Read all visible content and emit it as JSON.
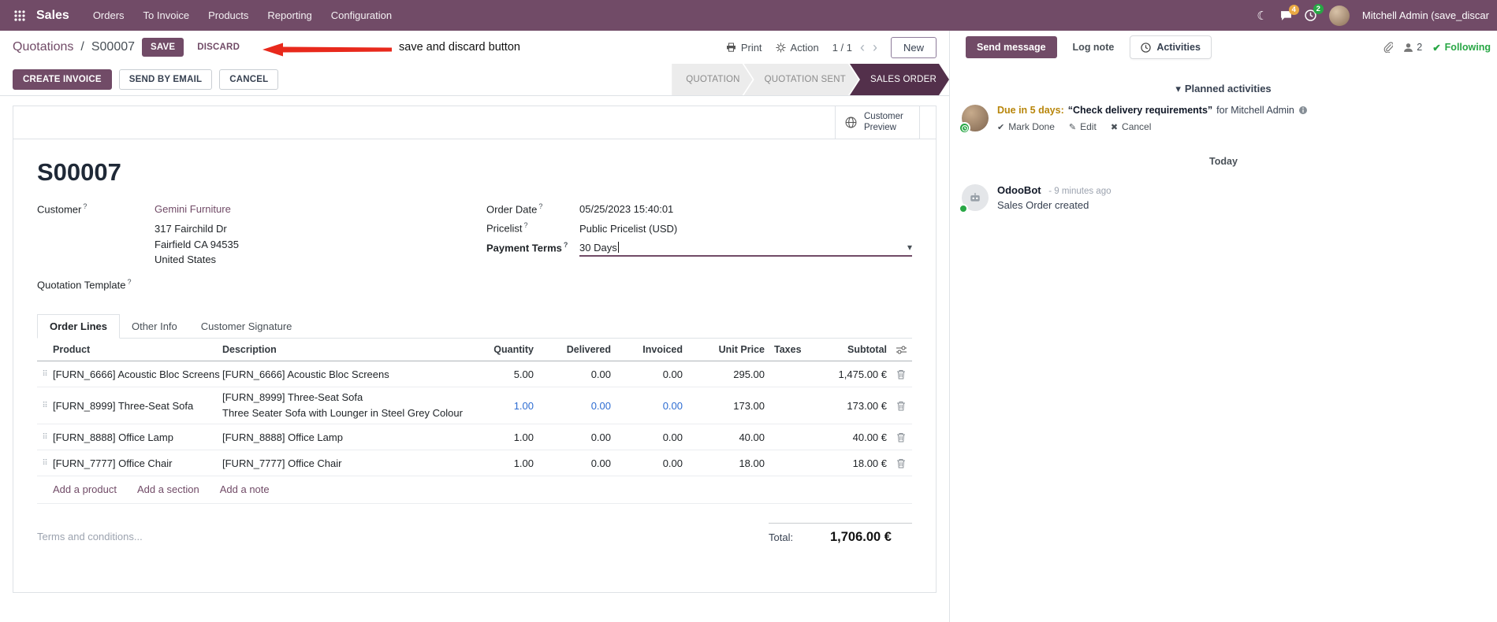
{
  "colors": {
    "brand": "#714B67",
    "topbar_bg": "#714B67",
    "status_active_bg": "#53304b",
    "link": "#714B67",
    "edited_value_blue": "#2e6dd2",
    "activity_due_soon": "#b8860b",
    "success_green": "#28a745",
    "annotation_red": "#e8291c"
  },
  "icons": {
    "moon": "☾",
    "caret_down": "▾",
    "chevron_left": "‹",
    "chevron_right": "›",
    "check": "✔",
    "pencil": "✎",
    "cross": "✖",
    "drag_handle": "⠿"
  },
  "topbar": {
    "brand": "Sales",
    "menus": [
      "Orders",
      "To Invoice",
      "Products",
      "Reporting",
      "Configuration"
    ],
    "messages_badge": "4",
    "activities_badge": "2",
    "user_name": "Mitchell Admin (save_discar"
  },
  "breadcrumb": {
    "parent": "Quotations",
    "separator": "/",
    "current": "S00007",
    "save_label": "SAVE",
    "discard_label": "DISCARD"
  },
  "annotation": {
    "text": "save and discard button"
  },
  "controls": {
    "print_label": "Print",
    "action_label": "Action",
    "pager": "1 / 1",
    "new_label": "New"
  },
  "statusbar": {
    "buttons": [
      "CREATE INVOICE",
      "SEND BY EMAIL",
      "CANCEL"
    ],
    "states": [
      {
        "label": "QUOTATION",
        "active": false
      },
      {
        "label": "QUOTATION SENT",
        "active": false
      },
      {
        "label": "SALES ORDER",
        "active": true
      }
    ]
  },
  "sheet": {
    "customer_preview_label": "Customer Preview",
    "title": "S00007",
    "help_marker": "?",
    "fields": {
      "customer_label": "Customer",
      "customer_value": "Gemini Furniture",
      "address_line1": "317 Fairchild Dr",
      "address_line2": "Fairfield CA 94535",
      "address_line3": "United States",
      "quotation_template_label": "Quotation Template",
      "order_date_label": "Order Date",
      "order_date_value": "05/25/2023 15:40:01",
      "pricelist_label": "Pricelist",
      "pricelist_value": "Public Pricelist (USD)",
      "payment_terms_label": "Payment Terms",
      "payment_terms_value": "30 Days"
    },
    "tabs": [
      "Order Lines",
      "Other Info",
      "Customer Signature"
    ],
    "table": {
      "headers": [
        "Product",
        "Description",
        "Quantity",
        "Delivered",
        "Invoiced",
        "Unit Price",
        "Taxes",
        "Subtotal"
      ],
      "rows": [
        {
          "product": "[FURN_6666] Acoustic Bloc Screens",
          "description": "[FURN_6666] Acoustic Bloc Screens",
          "quantity": "5.00",
          "delivered": "0.00",
          "invoiced": "0.00",
          "unit_price": "295.00",
          "taxes": "",
          "subtotal": "1,475.00 €"
        },
        {
          "product": "[FURN_8999] Three-Seat Sofa",
          "description": "[FURN_8999] Three-Seat Sofa",
          "description_line2": "Three Seater Sofa with Lounger in Steel Grey Colour",
          "quantity": "1.00",
          "delivered": "0.00",
          "invoiced": "0.00",
          "unit_price": "173.00",
          "taxes": "",
          "subtotal": "173.00 €"
        },
        {
          "product": "[FURN_8888] Office Lamp",
          "description": "[FURN_8888] Office Lamp",
          "quantity": "1.00",
          "delivered": "0.00",
          "invoiced": "0.00",
          "unit_price": "40.00",
          "taxes": "",
          "subtotal": "40.00 €"
        },
        {
          "product": "[FURN_7777] Office Chair",
          "description": "[FURN_7777] Office Chair",
          "quantity": "1.00",
          "delivered": "0.00",
          "invoiced": "0.00",
          "unit_price": "18.00",
          "taxes": "",
          "subtotal": "18.00 €"
        }
      ],
      "footer_links": [
        "Add a product",
        "Add a section",
        "Add a note"
      ]
    },
    "terms_placeholder": "Terms and conditions...",
    "total_label": "Total:",
    "total_value": "1,706.00 €"
  },
  "chatter": {
    "send_message_label": "Send message",
    "log_note_label": "Log note",
    "activities_label": "Activities",
    "followers_count": "2",
    "following_label": "Following",
    "planned_header": "Planned activities",
    "activity": {
      "due_text": "Due in 5 days:",
      "summary": "“Check delivery requirements”",
      "assignee_text": "for Mitchell Admin",
      "mark_done_label": "Mark Done",
      "edit_label": "Edit",
      "cancel_label": "Cancel"
    },
    "date_divider": "Today",
    "message": {
      "author": "OdooBot",
      "timestamp": "- 9 minutes ago",
      "body": "Sales Order created"
    }
  }
}
